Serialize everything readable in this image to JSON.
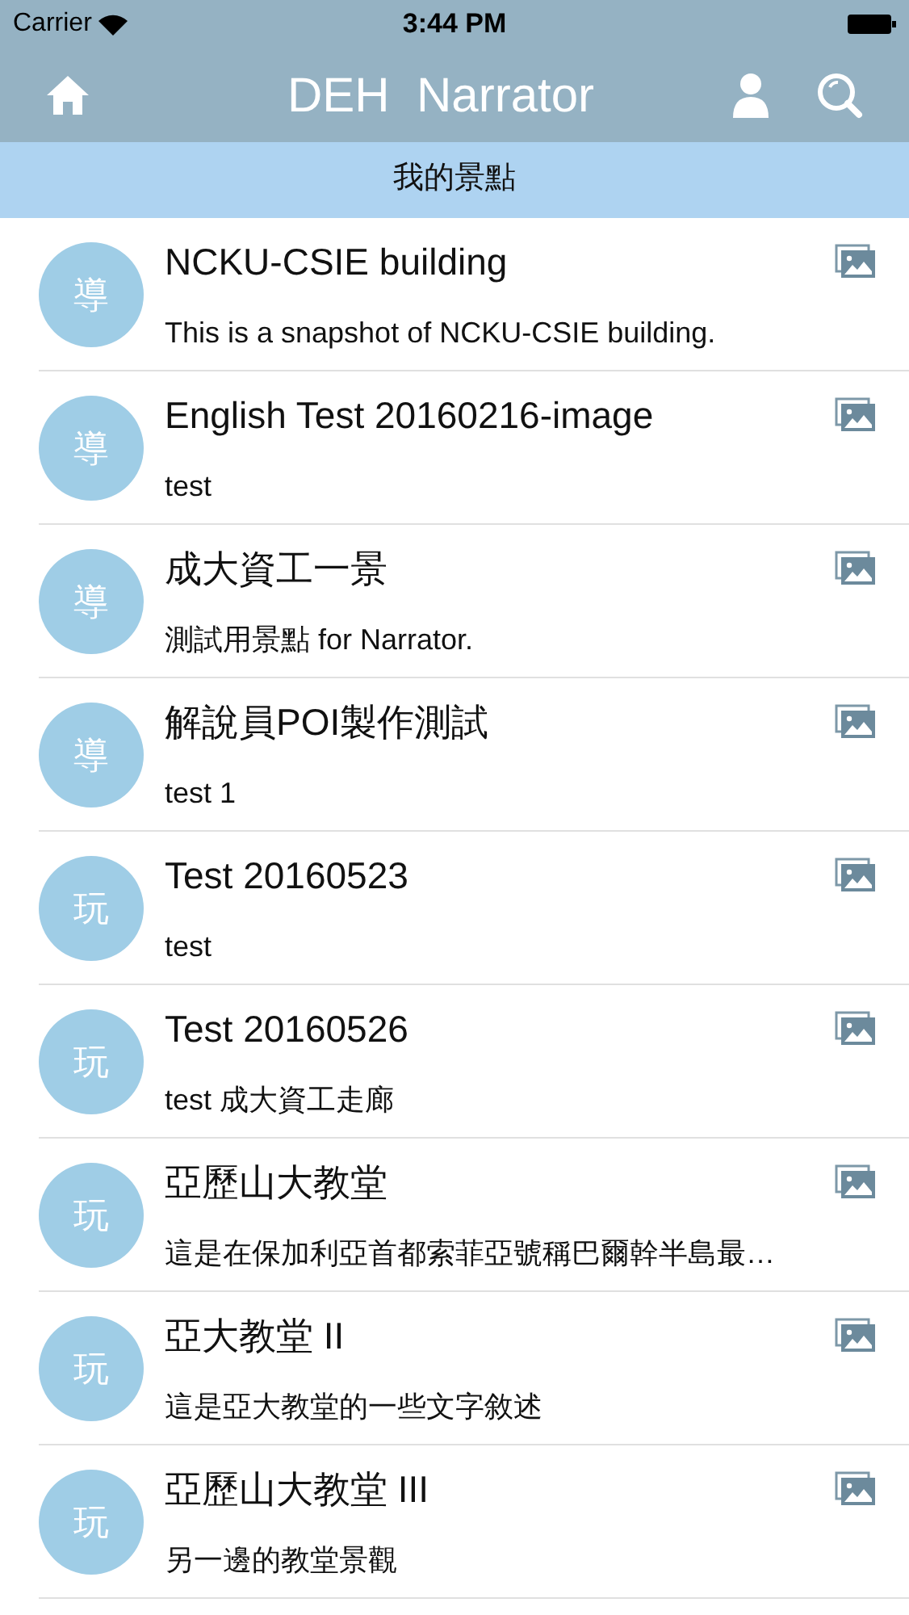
{
  "status_bar": {
    "carrier": "Carrier",
    "time": "3:44 PM"
  },
  "nav": {
    "title": "DEH  Narrator"
  },
  "section": {
    "title": "我的景點"
  },
  "items": [
    {
      "badge": "導",
      "title": "NCKU-CSIE building",
      "subtitle": "This is a snapshot of NCKU-CSIE building."
    },
    {
      "badge": "導",
      "title": "English Test 20160216-image",
      "subtitle": "test"
    },
    {
      "badge": "導",
      "title": "成大資工一景",
      "subtitle": "測試用景點 for Narrator."
    },
    {
      "badge": "導",
      "title": "解說員POI製作測試",
      "subtitle": "test 1"
    },
    {
      "badge": "玩",
      "title": "Test 20160523",
      "subtitle": "test"
    },
    {
      "badge": "玩",
      "title": "Test 20160526",
      "subtitle": "test 成大資工走廊"
    },
    {
      "badge": "玩",
      "title": "亞歷山大教堂",
      "subtitle": "這是在保加利亞首都索菲亞號稱巴爾幹半島最…"
    },
    {
      "badge": "玩",
      "title": "亞大教堂 II",
      "subtitle": "這是亞大教堂的一些文字敘述"
    },
    {
      "badge": "玩",
      "title": "亞歷山大教堂 III",
      "subtitle": "另一邊的教堂景觀"
    }
  ]
}
